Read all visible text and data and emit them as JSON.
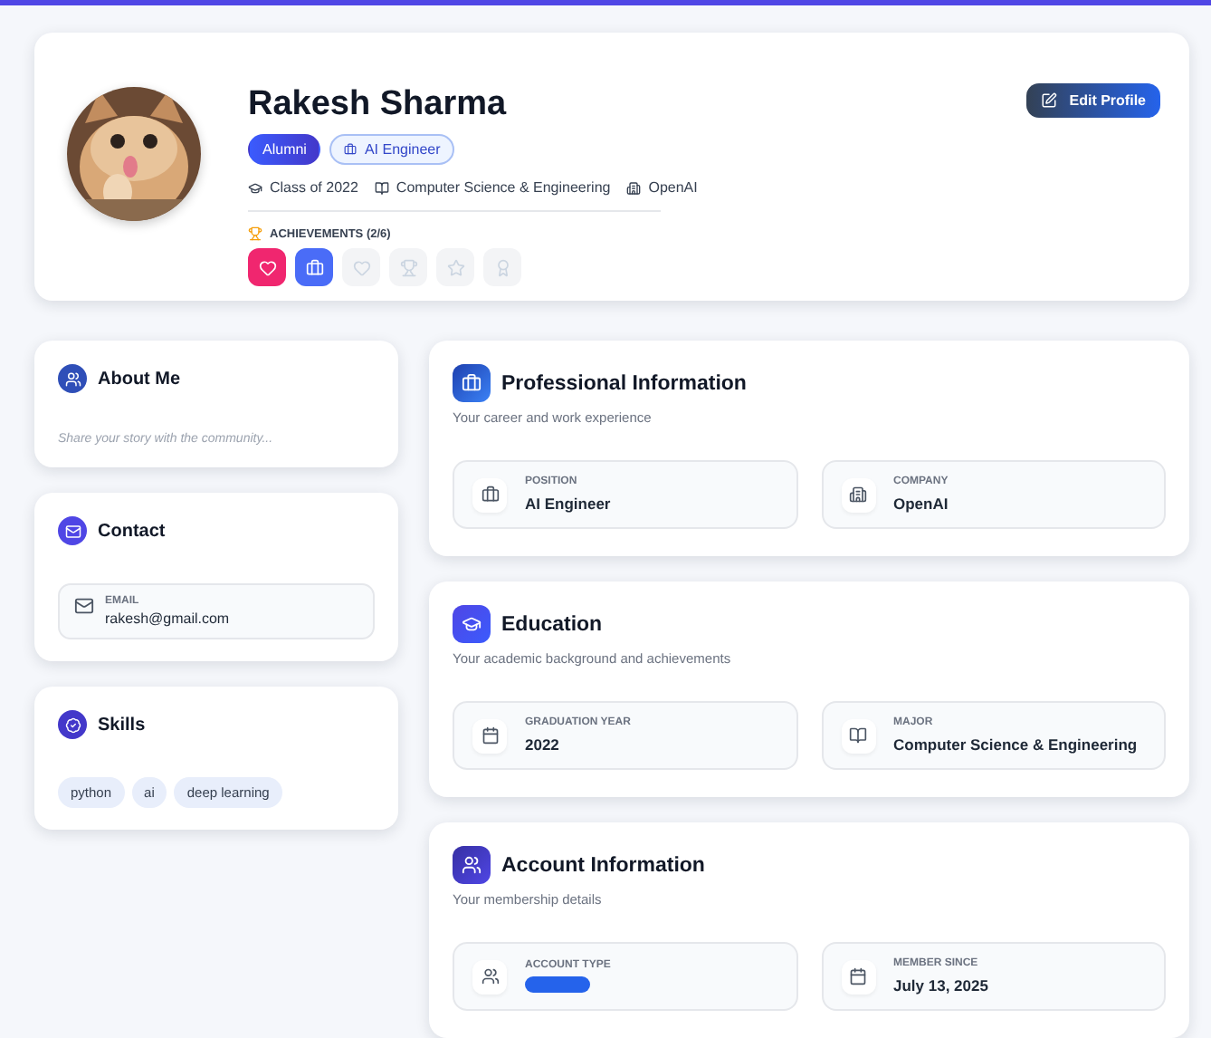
{
  "profile": {
    "name": "Rakesh Sharma",
    "badges": [
      {
        "kind": "role",
        "label": "Alumni"
      },
      {
        "kind": "job",
        "label": "AI Engineer"
      }
    ],
    "meta": [
      {
        "kind": "class",
        "text": "Class of 2022"
      },
      {
        "kind": "major",
        "text": "Computer Science & Engineering"
      },
      {
        "kind": "company",
        "text": "OpenAI"
      }
    ],
    "achievements_title": "ACHIEVEMENTS (2/6)",
    "achievements": [
      {
        "kind": "heart",
        "earned": true,
        "color": "#f0266f"
      },
      {
        "kind": "briefcase",
        "earned": true,
        "color": "#4a6cf7"
      },
      {
        "kind": "heart",
        "earned": false
      },
      {
        "kind": "trophy",
        "earned": false
      },
      {
        "kind": "star",
        "earned": false
      },
      {
        "kind": "award",
        "earned": false
      }
    ],
    "edit_button": "Edit Profile"
  },
  "side_cards": [
    {
      "kind": "about",
      "title": "About Me",
      "placeholder": "Share your story with the community..."
    },
    {
      "kind": "contact",
      "title": "Contact",
      "email_label": "EMAIL",
      "email": "rakesh@gmail.com"
    },
    {
      "kind": "skills",
      "title": "Skills",
      "skills": [
        "python",
        "ai",
        "deep learning"
      ]
    }
  ],
  "sections": [
    {
      "kind": "professional",
      "title": "Professional Information",
      "subtitle": "Your career and work experience",
      "fields": [
        {
          "kind": "position",
          "label": "POSITION",
          "value": "AI Engineer"
        },
        {
          "kind": "company",
          "label": "COMPANY",
          "value": "OpenAI"
        }
      ]
    },
    {
      "kind": "education",
      "title": "Education",
      "subtitle": "Your academic background and achievements",
      "fields": [
        {
          "kind": "graduation_year",
          "label": "GRADUATION YEAR",
          "value": "2022"
        },
        {
          "kind": "major",
          "label": "MAJOR",
          "value": "Computer Science & Engineering"
        }
      ]
    },
    {
      "kind": "account",
      "title": "Account Information",
      "subtitle": "Your membership details",
      "fields": [
        {
          "kind": "account_type",
          "label": "ACCOUNT TYPE"
        },
        {
          "kind": "member_since",
          "label": "MEMBER SINCE",
          "value": "July 13, 2025"
        }
      ]
    }
  ]
}
